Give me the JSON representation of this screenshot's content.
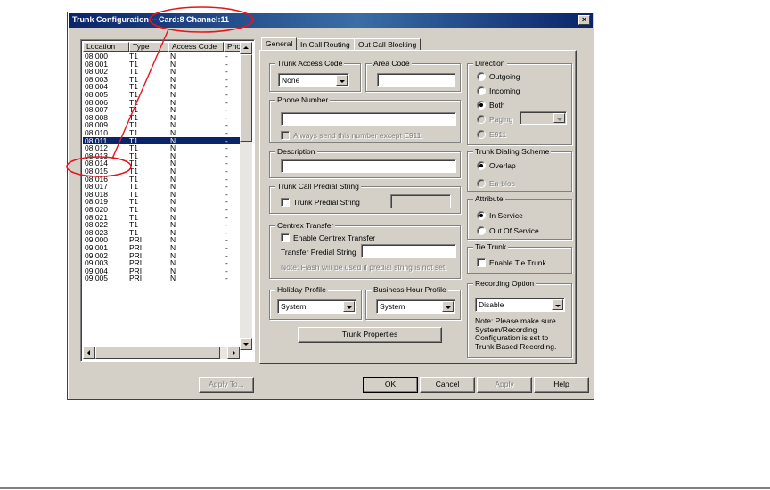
{
  "window": {
    "title": "Trunk Configuration -- Card:8 Channel:11",
    "close_glyph": "×"
  },
  "list": {
    "columns": [
      "Location",
      "Type",
      "Access Code",
      "Pho"
    ],
    "rows": [
      [
        "08:000",
        "T1",
        "N",
        "-"
      ],
      [
        "08:001",
        "T1",
        "N",
        "-"
      ],
      [
        "08:002",
        "T1",
        "N",
        "-"
      ],
      [
        "08:003",
        "T1",
        "N",
        "-"
      ],
      [
        "08:004",
        "T1",
        "N",
        "-"
      ],
      [
        "08:005",
        "T1",
        "N",
        "-"
      ],
      [
        "08:006",
        "T1",
        "N",
        "-"
      ],
      [
        "08:007",
        "T1",
        "N",
        "-"
      ],
      [
        "08:008",
        "T1",
        "N",
        "-"
      ],
      [
        "08:009",
        "T1",
        "N",
        "-"
      ],
      [
        "08:010",
        "T1",
        "N",
        "-"
      ],
      [
        "08:011",
        "T1",
        "N",
        "-"
      ],
      [
        "08:012",
        "T1",
        "N",
        "-"
      ],
      [
        "08:013",
        "T1",
        "N",
        "-"
      ],
      [
        "08:014",
        "T1",
        "N",
        "-"
      ],
      [
        "08:015",
        "T1",
        "N",
        "-"
      ],
      [
        "08:016",
        "T1",
        "N",
        "-"
      ],
      [
        "08:017",
        "T1",
        "N",
        "-"
      ],
      [
        "08:018",
        "T1",
        "N",
        "-"
      ],
      [
        "08:019",
        "T1",
        "N",
        "-"
      ],
      [
        "08:020",
        "T1",
        "N",
        "-"
      ],
      [
        "08:021",
        "T1",
        "N",
        "-"
      ],
      [
        "08:022",
        "T1",
        "N",
        "-"
      ],
      [
        "08:023",
        "T1",
        "N",
        "-"
      ],
      [
        "09:000",
        "PRI",
        "N",
        "-"
      ],
      [
        "09:001",
        "PRI",
        "N",
        "-"
      ],
      [
        "09:002",
        "PRI",
        "N",
        "-"
      ],
      [
        "09:003",
        "PRI",
        "N",
        "-"
      ],
      [
        "09:004",
        "PRI",
        "N",
        "-"
      ],
      [
        "09:005",
        "PRI",
        "N",
        "-"
      ]
    ],
    "selected_index": 11
  },
  "tabs": [
    "General",
    "In Call Routing",
    "Out Call Blocking"
  ],
  "active_tab": 0,
  "general": {
    "trunk_access_code": {
      "label": "Trunk Access Code",
      "value": "None"
    },
    "area_code": {
      "label": "Area Code",
      "value": ""
    },
    "phone_number": {
      "label": "Phone Number",
      "value": "",
      "checkbox_label": "Always send this number except E911."
    },
    "description": {
      "label": "Description",
      "value": ""
    },
    "trunk_call_predial": {
      "label": "Trunk Call Predial String",
      "checkbox_label": "Trunk Predial String",
      "value": ""
    },
    "centrex": {
      "label": "Centrex Transfer",
      "checkbox_label": "Enable Centrex Transfer",
      "transfer_label": "Transfer Predial String",
      "value": "",
      "note": "Note: Flash will be used if predial string is not set."
    },
    "holiday_profile": {
      "label": "Holiday Profile",
      "value": "System"
    },
    "business_hour_profile": {
      "label": "Business Hour Profile",
      "value": "System"
    },
    "trunk_properties_button": "Trunk Properties",
    "direction": {
      "label": "Direction",
      "options": [
        "Outgoing",
        "Incoming",
        "Both",
        "Paging",
        "E911"
      ],
      "selected": "Both",
      "paging_value": ""
    },
    "dialing_scheme": {
      "label": "Trunk Dialing Scheme",
      "options": [
        "Overlap",
        "En-bloc"
      ],
      "selected": "Overlap"
    },
    "attribute": {
      "label": "Attribute",
      "options": [
        "In Service",
        "Out Of Service"
      ],
      "selected": "In Service"
    },
    "tie_trunk": {
      "label": "Tie Trunk",
      "checkbox_label": "Enable Tie Trunk"
    },
    "recording": {
      "label": "Recording Option",
      "value": "Disable",
      "note": "Note: Please make sure System/Recording Configuration is set to Trunk Based Recording."
    }
  },
  "buttons": {
    "apply_to": "Apply To...",
    "ok": "OK",
    "cancel": "Cancel",
    "apply": "Apply",
    "help": "Help"
  },
  "colors": {
    "title_bar": "#0a246a",
    "selection": "#0a246a",
    "annotation": "#e8141c",
    "dialog_face": "#d4d0c8"
  }
}
